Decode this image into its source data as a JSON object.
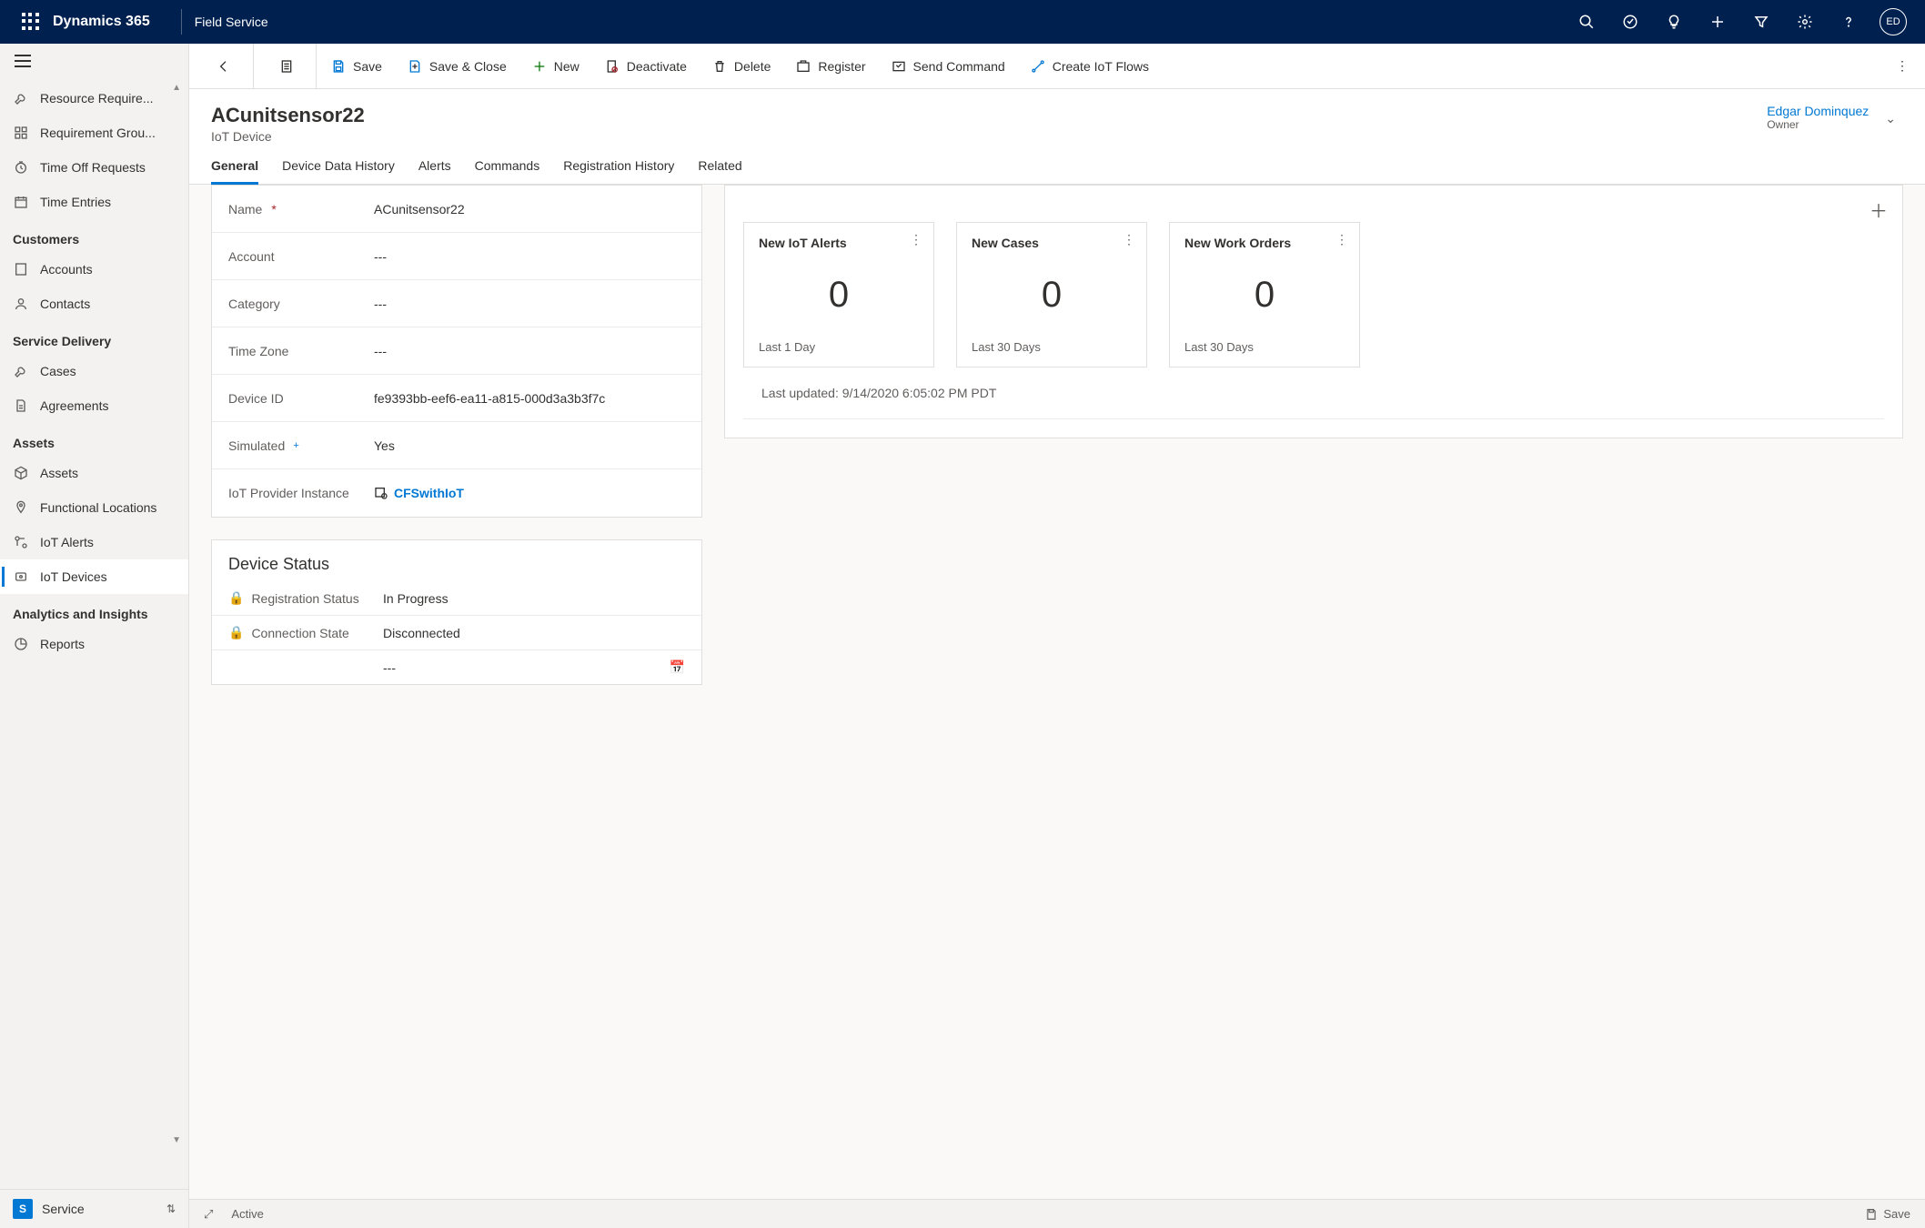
{
  "topnav": {
    "brand": "Dynamics 365",
    "app": "Field Service",
    "avatar": "ED"
  },
  "sidebar": {
    "groups": [
      {
        "items": [
          {
            "label": "Resource Require...",
            "icon": "wrench",
            "active": false
          },
          {
            "label": "Requirement Grou...",
            "icon": "grid",
            "active": false
          },
          {
            "label": "Time Off Requests",
            "icon": "clock",
            "active": false
          },
          {
            "label": "Time Entries",
            "icon": "calendar",
            "active": false
          }
        ]
      },
      {
        "title": "Customers",
        "items": [
          {
            "label": "Accounts",
            "icon": "building",
            "active": false
          },
          {
            "label": "Contacts",
            "icon": "person",
            "active": false
          }
        ]
      },
      {
        "title": "Service Delivery",
        "items": [
          {
            "label": "Cases",
            "icon": "wrench",
            "active": false
          },
          {
            "label": "Agreements",
            "icon": "doc",
            "active": false
          }
        ]
      },
      {
        "title": "Assets",
        "items": [
          {
            "label": "Assets",
            "icon": "cube",
            "active": false
          },
          {
            "label": "Functional Locations",
            "icon": "pin",
            "active": false
          },
          {
            "label": "IoT Alerts",
            "icon": "alert",
            "active": false
          },
          {
            "label": "IoT Devices",
            "icon": "device",
            "active": true
          }
        ]
      },
      {
        "title": "Analytics and Insights",
        "items": [
          {
            "label": "Reports",
            "icon": "report",
            "active": false
          }
        ]
      }
    ],
    "area": {
      "badge": "S",
      "label": "Service"
    }
  },
  "commands": {
    "save": "Save",
    "saveclose": "Save & Close",
    "new": "New",
    "deactivate": "Deactivate",
    "delete": "Delete",
    "register": "Register",
    "sendcmd": "Send Command",
    "createflows": "Create IoT Flows"
  },
  "record": {
    "title": "ACunitsensor22",
    "subtitle": "IoT Device",
    "owner_name": "Edgar Dominquez",
    "owner_label": "Owner"
  },
  "tabs": [
    "General",
    "Device Data History",
    "Alerts",
    "Commands",
    "Registration History",
    "Related"
  ],
  "active_tab": 0,
  "form": {
    "name": {
      "label": "Name",
      "value": "ACunitsensor22",
      "required": true
    },
    "account": {
      "label": "Account",
      "value": "---"
    },
    "category": {
      "label": "Category",
      "value": "---"
    },
    "timezone": {
      "label": "Time Zone",
      "value": "---"
    },
    "deviceid": {
      "label": "Device ID",
      "value": "fe9393bb-eef6-ea11-a815-000d3a3b3f7c"
    },
    "simulated": {
      "label": "Simulated",
      "value": "Yes",
      "recommended": true
    },
    "provider": {
      "label": "IoT Provider Instance",
      "value": "CFSwithIoT",
      "lookup": true
    }
  },
  "status_section": {
    "title": "Device Status",
    "reg": {
      "label": "Registration Status",
      "value": "In Progress"
    },
    "conn": {
      "label": "Connection State",
      "value": "Disconnected"
    },
    "extra_value": "---"
  },
  "kpis": [
    {
      "title": "New IoT Alerts",
      "value": "0",
      "footer": "Last 1 Day"
    },
    {
      "title": "New Cases",
      "value": "0",
      "footer": "Last 30 Days"
    },
    {
      "title": "New Work Orders",
      "value": "0",
      "footer": "Last 30 Days"
    }
  ],
  "last_updated": "Last updated: 9/14/2020 6:05:02 PM PDT",
  "statusbar": {
    "state": "Active",
    "save": "Save"
  }
}
